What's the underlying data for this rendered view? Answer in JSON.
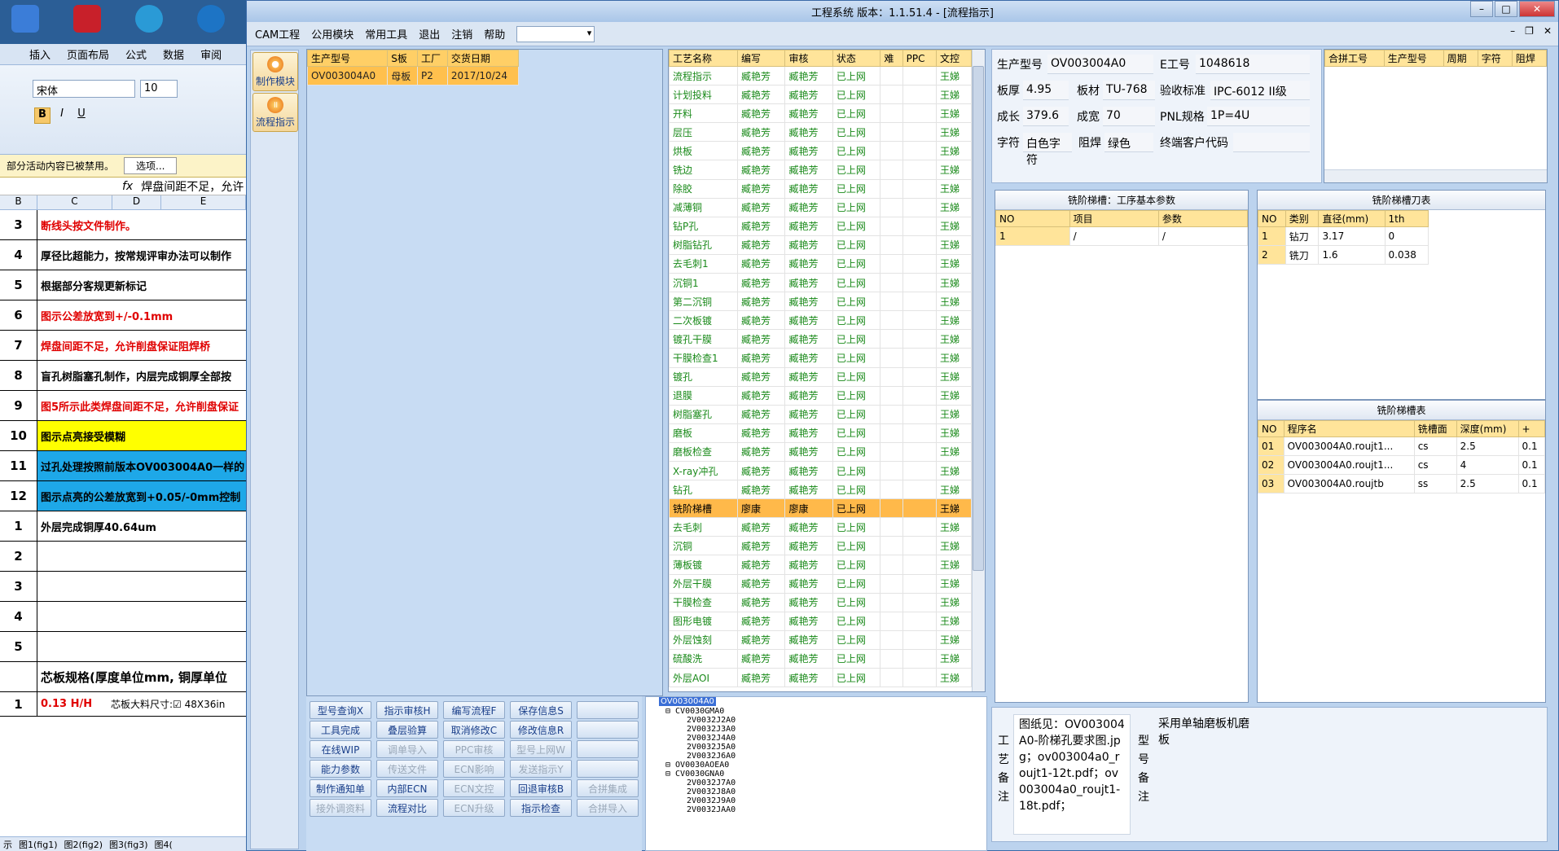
{
  "window": {
    "title": "工程系统    版本：1.1.51.4 - [流程指示]"
  },
  "menu": {
    "items": [
      "CAM工程",
      "公用模块",
      "常用工具",
      "退出",
      "注销",
      "帮助"
    ]
  },
  "nav": {
    "items": [
      {
        "label": "制作模块"
      },
      {
        "label": "流程指示"
      }
    ]
  },
  "order_grid": {
    "headers": [
      "生产型号",
      "S板",
      "工厂",
      "交货日期"
    ],
    "rows": [
      [
        "OV003004A0",
        "母板",
        "P2",
        "2017/10/24"
      ]
    ]
  },
  "process_grid": {
    "headers": [
      "工艺名称",
      "编写",
      "审核",
      "状态",
      "难",
      "PPC",
      "文控"
    ],
    "rows": [
      [
        "流程指示",
        "臧艳芳",
        "臧艳芳",
        "已上网",
        "",
        "",
        "王娣"
      ],
      [
        "计划投料",
        "臧艳芳",
        "臧艳芳",
        "已上网",
        "",
        "",
        "王娣"
      ],
      [
        "开料",
        "臧艳芳",
        "臧艳芳",
        "已上网",
        "",
        "",
        "王娣"
      ],
      [
        "层压",
        "臧艳芳",
        "臧艳芳",
        "已上网",
        "",
        "",
        "王娣"
      ],
      [
        "烘板",
        "臧艳芳",
        "臧艳芳",
        "已上网",
        "",
        "",
        "王娣"
      ],
      [
        "铣边",
        "臧艳芳",
        "臧艳芳",
        "已上网",
        "",
        "",
        "王娣"
      ],
      [
        "除胶",
        "臧艳芳",
        "臧艳芳",
        "已上网",
        "",
        "",
        "王娣"
      ],
      [
        "减薄铜",
        "臧艳芳",
        "臧艳芳",
        "已上网",
        "",
        "",
        "王娣"
      ],
      [
        "钻P孔",
        "臧艳芳",
        "臧艳芳",
        "已上网",
        "",
        "",
        "王娣"
      ],
      [
        "树脂钻孔",
        "臧艳芳",
        "臧艳芳",
        "已上网",
        "",
        "",
        "王娣"
      ],
      [
        "去毛刺1",
        "臧艳芳",
        "臧艳芳",
        "已上网",
        "",
        "",
        "王娣"
      ],
      [
        "沉铜1",
        "臧艳芳",
        "臧艳芳",
        "已上网",
        "",
        "",
        "王娣"
      ],
      [
        "第二沉铜",
        "臧艳芳",
        "臧艳芳",
        "已上网",
        "",
        "",
        "王娣"
      ],
      [
        "二次板镀",
        "臧艳芳",
        "臧艳芳",
        "已上网",
        "",
        "",
        "王娣"
      ],
      [
        "镀孔干膜",
        "臧艳芳",
        "臧艳芳",
        "已上网",
        "",
        "",
        "王娣"
      ],
      [
        "干膜检查1",
        "臧艳芳",
        "臧艳芳",
        "已上网",
        "",
        "",
        "王娣"
      ],
      [
        "镀孔",
        "臧艳芳",
        "臧艳芳",
        "已上网",
        "",
        "",
        "王娣"
      ],
      [
        "退膜",
        "臧艳芳",
        "臧艳芳",
        "已上网",
        "",
        "",
        "王娣"
      ],
      [
        "树脂塞孔",
        "臧艳芳",
        "臧艳芳",
        "已上网",
        "",
        "",
        "王娣"
      ],
      [
        "磨板",
        "臧艳芳",
        "臧艳芳",
        "已上网",
        "",
        "",
        "王娣"
      ],
      [
        "磨板检查",
        "臧艳芳",
        "臧艳芳",
        "已上网",
        "",
        "",
        "王娣"
      ],
      [
        "X-ray冲孔",
        "臧艳芳",
        "臧艳芳",
        "已上网",
        "",
        "",
        "王娣"
      ],
      [
        "钻孔",
        "臧艳芳",
        "臧艳芳",
        "已上网",
        "",
        "",
        "王娣"
      ],
      [
        "铣阶梯槽",
        "廖康",
        "廖康",
        "已上网",
        "",
        "",
        "王娣"
      ],
      [
        "去毛刺",
        "臧艳芳",
        "臧艳芳",
        "已上网",
        "",
        "",
        "王娣"
      ],
      [
        "沉铜",
        "臧艳芳",
        "臧艳芳",
        "已上网",
        "",
        "",
        "王娣"
      ],
      [
        "薄板镀",
        "臧艳芳",
        "臧艳芳",
        "已上网",
        "",
        "",
        "王娣"
      ],
      [
        "外层干膜",
        "臧艳芳",
        "臧艳芳",
        "已上网",
        "",
        "",
        "王娣"
      ],
      [
        "干膜检查",
        "臧艳芳",
        "臧艳芳",
        "已上网",
        "",
        "",
        "王娣"
      ],
      [
        "图形电镀",
        "臧艳芳",
        "臧艳芳",
        "已上网",
        "",
        "",
        "王娣"
      ],
      [
        "外层蚀刻",
        "臧艳芳",
        "臧艳芳",
        "已上网",
        "",
        "",
        "王娣"
      ],
      [
        "硫酸洗",
        "臧艳芳",
        "臧艳芳",
        "已上网",
        "",
        "",
        "王娣"
      ],
      [
        "外层AOI",
        "臧艳芳",
        "臧艳芳",
        "已上网",
        "",
        "",
        "王娣"
      ]
    ],
    "selected_index": 23
  },
  "info": {
    "labels": {
      "model": "生产型号",
      "e_no": "E工号",
      "thickness": "板厚",
      "material": "板材",
      "standard": "验收标准",
      "length": "成长",
      "width": "成宽",
      "pnl": "PNL规格",
      "char": "字符",
      "solder": "阻焊",
      "customer_code": "终端客户代码"
    },
    "values": {
      "model": "OV003004A0",
      "e_no": "1048618",
      "thickness": "4.95",
      "material": "TU-768",
      "standard": "IPC-6012 II级",
      "length": "379.6",
      "width": "70",
      "pnl": "1P=4U",
      "char": "白色字符",
      "solder": "绿色",
      "customer_code": ""
    }
  },
  "merge_grid": {
    "headers": [
      "合拼工号",
      "生产型号",
      "周期",
      "字符",
      "阻焊"
    ]
  },
  "base_params": {
    "title": "铣阶梯槽：工序基本参数",
    "headers": [
      "NO",
      "项目",
      "参数"
    ],
    "rows": [
      [
        "1",
        "/",
        "/"
      ]
    ]
  },
  "tool_table": {
    "title": "铣阶梯槽刀表",
    "headers": [
      "NO",
      "类别",
      "直径(mm)",
      "1th"
    ],
    "rows": [
      [
        "1",
        "钻刀",
        "3.17",
        "0"
      ],
      [
        "2",
        "铣刀",
        "1.6",
        "0.038"
      ]
    ]
  },
  "slot_table": {
    "title": "铣阶梯槽表",
    "headers": [
      "NO",
      "程序名",
      "铣槽面",
      "深度(mm)",
      "+"
    ],
    "rows": [
      [
        "01",
        "OV003004A0.roujt1...",
        "cs",
        "2.5",
        "0.1"
      ],
      [
        "02",
        "OV003004A0.roujt1...",
        "cs",
        "4",
        "0.1"
      ],
      [
        "03",
        "OV003004A0.roujtb",
        "ss",
        "2.5",
        "0.1"
      ]
    ]
  },
  "notes": {
    "process_label": "工艺备注",
    "process_text": "图纸见：OV003004A0-阶梯孔要求图.jpg；ov003004a0_roujt1-12t.pdf；ov003004a0_roujt1-18t.pdf；",
    "model_label": "型号备注",
    "model_text": "采用单轴磨板机磨板"
  },
  "actions": [
    {
      "label": "型号查询X",
      "enabled": true
    },
    {
      "label": "指示审核H",
      "enabled": true
    },
    {
      "label": "编写流程F",
      "enabled": true
    },
    {
      "label": "保存信息S",
      "enabled": true
    },
    {
      "label": "",
      "enabled": true
    },
    {
      "label": "工具完成",
      "enabled": true
    },
    {
      "label": "叠层验算",
      "enabled": true
    },
    {
      "label": "取消修改C",
      "enabled": true
    },
    {
      "label": "修改信息R",
      "enabled": true
    },
    {
      "label": "",
      "enabled": true
    },
    {
      "label": "在线WIP",
      "enabled": true
    },
    {
      "label": "调单导入",
      "enabled": false
    },
    {
      "label": "PPC审核",
      "enabled": false
    },
    {
      "label": "型号上网W",
      "enabled": false
    },
    {
      "label": "",
      "enabled": true
    },
    {
      "label": "能力参数",
      "enabled": true
    },
    {
      "label": "传送文件",
      "enabled": false
    },
    {
      "label": "ECN影响",
      "enabled": false
    },
    {
      "label": "发送指示Y",
      "enabled": false
    },
    {
      "label": "",
      "enabled": true
    },
    {
      "label": "制作通知单",
      "enabled": true
    },
    {
      "label": "内部ECN",
      "enabled": true
    },
    {
      "label": "ECN文控",
      "enabled": false
    },
    {
      "label": "回退审核B",
      "enabled": true
    },
    {
      "label": "合拼集成",
      "enabled": false
    },
    {
      "label": "接外调资料",
      "enabled": false
    },
    {
      "label": "流程对比",
      "enabled": true
    },
    {
      "label": "ECN升级",
      "enabled": false
    },
    {
      "label": "指示检查",
      "enabled": true
    },
    {
      "label": "合拼导入",
      "enabled": false
    }
  ],
  "tree": {
    "root": "OV003004A0",
    "nodes": [
      {
        "label": "CV0030GMA0",
        "level": 1
      },
      {
        "label": "2V0032J2A0",
        "level": 2
      },
      {
        "label": "2V0032J3A0",
        "level": 2
      },
      {
        "label": "2V0032J4A0",
        "level": 2
      },
      {
        "label": "2V0032J5A0",
        "level": 2
      },
      {
        "label": "2V0032J6A0",
        "level": 2
      },
      {
        "label": "OV0030AOEA0",
        "level": 1
      },
      {
        "label": "CV0030GNA0",
        "level": 1
      },
      {
        "label": "2V0032J7A0",
        "level": 2
      },
      {
        "label": "2V0032J8A0",
        "level": 2
      },
      {
        "label": "2V0032J9A0",
        "level": 2
      },
      {
        "label": "2V0032JAA0",
        "level": 2
      }
    ]
  },
  "excel": {
    "tabs": [
      "插入",
      "页面布局",
      "公式",
      "数据",
      "审阅"
    ],
    "font": "宋体",
    "size": "10",
    "security_msg": "部分活动内容已被禁用。",
    "options_btn": "选项...",
    "formula_text": "焊盘间距不足，允许",
    "cols": [
      "B",
      "C",
      "D",
      "E"
    ],
    "rows": [
      {
        "num": "3",
        "text": "断线头按文件制作。",
        "color": "#e00000",
        "bg": "#fff"
      },
      {
        "num": "4",
        "text": "厚径比超能力，按常规评审办法可以制作",
        "color": "#000",
        "bg": "#fff"
      },
      {
        "num": "5",
        "text": "根据部分客规更新标记",
        "color": "#000",
        "bg": "#fff"
      },
      {
        "num": "6",
        "text": "图示公差放宽到+/-0.1mm",
        "color": "#e00000",
        "bg": "#fff"
      },
      {
        "num": "7",
        "text": "焊盘间距不足，允许削盘保证阻焊桥",
        "color": "#e00000",
        "bg": "#fff"
      },
      {
        "num": "8",
        "text": "盲孔树脂塞孔制作，内层完成铜厚全部按",
        "color": "#000",
        "bg": "#fff"
      },
      {
        "num": "9",
        "text": "图5所示此类焊盘间距不足，允许削盘保证",
        "color": "#e00000",
        "bg": "#fff"
      },
      {
        "num": "10",
        "text": "图示点亮接受模糊",
        "color": "#000",
        "bg": "#ffff00"
      },
      {
        "num": "11",
        "text": "过孔处理按照前版本OV003004A0一样的",
        "color": "#000",
        "bg": "#1ea8e8"
      },
      {
        "num": "12",
        "text": "图示点亮的公差放宽到+0.05/-0mm控制",
        "color": "#000",
        "bg": "#1ea8e8"
      },
      {
        "num": "1",
        "text": "外层完成铜厚40.64um",
        "color": "#000",
        "bg": "#fff"
      },
      {
        "num": "2",
        "text": "",
        "color": "#000",
        "bg": "#fff"
      },
      {
        "num": "3",
        "text": "",
        "color": "#000",
        "bg": "#fff"
      },
      {
        "num": "4",
        "text": "",
        "color": "#000",
        "bg": "#fff"
      },
      {
        "num": "5",
        "text": "",
        "color": "#000",
        "bg": "#fff"
      }
    ],
    "spec_title": "芯板规格(厚度单位mm, 铜厚单位",
    "spec_row": {
      "num": "1",
      "value": "0.13 H/H",
      "extra": "芯板大料尺寸:☑ 48X36in"
    },
    "sheets": [
      "示",
      "图1(fig1)",
      "图2(fig2)",
      "图3(fig3)",
      "图4("
    ]
  }
}
